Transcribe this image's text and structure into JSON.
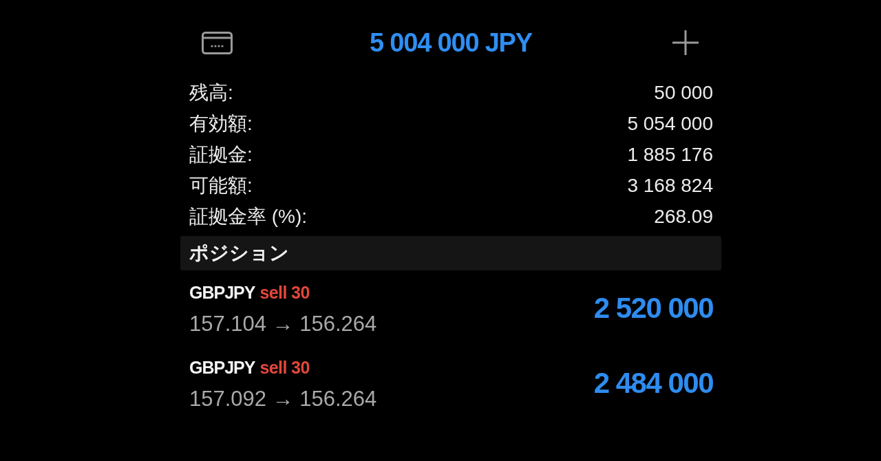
{
  "header": {
    "title": "5 004 000 JPY"
  },
  "summary": [
    {
      "label": "残高:",
      "value": "50 000"
    },
    {
      "label": "有効額:",
      "value": "5 054 000"
    },
    {
      "label": "証拠金:",
      "value": "1 885 176"
    },
    {
      "label": "可能額:",
      "value": "3 168 824"
    },
    {
      "label": "証拠金率 (%):",
      "value": "268.09"
    }
  ],
  "positions_section": {
    "title": "ポジション"
  },
  "positions": [
    {
      "symbol": "GBPJPY",
      "order": "sell 30",
      "prices": "157.104 → 156.264",
      "profit": "2 520 000"
    },
    {
      "symbol": "GBPJPY",
      "order": "sell 30",
      "prices": "157.092 → 156.264",
      "profit": "2 484 000"
    }
  ]
}
